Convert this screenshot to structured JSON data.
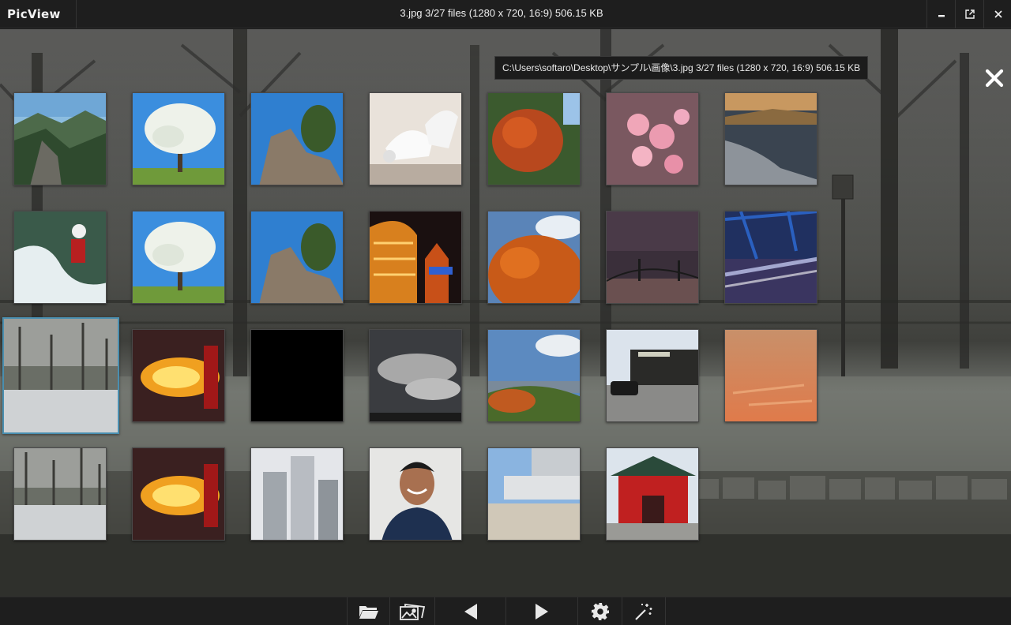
{
  "app": {
    "name": "PicView"
  },
  "titlebar": {
    "title": "3.jpg 3/27 files (1280 x 720, 16:9) 506.15 KB",
    "minimize_icon": "minimize-icon",
    "popout_icon": "open-external-icon",
    "close_icon": "close-icon"
  },
  "tooltip": {
    "text": "C:\\Users\\softaro\\Desktop\\サンプル\\画像\\3.jpg 3/27 files (1280 x 720, 16:9) 506.15 KB"
  },
  "gallery": {
    "selected_index": 14,
    "thumbnails": [
      {
        "subject": "mountain valley"
      },
      {
        "subject": "blossoming tree"
      },
      {
        "subject": "rock with pine tree"
      },
      {
        "subject": "seagulls"
      },
      {
        "subject": "autumn tree"
      },
      {
        "subject": "cherry blossoms"
      },
      {
        "subject": "rocky coast"
      },
      {
        "subject": "whitewater kayaker"
      },
      {
        "subject": "blossoming tree"
      },
      {
        "subject": "rock with pine tree"
      },
      {
        "subject": "lit building at night"
      },
      {
        "subject": "autumn tree"
      },
      {
        "subject": "suspension bridge at dusk"
      },
      {
        "subject": "city traffic at night"
      },
      {
        "subject": "winter park"
      },
      {
        "subject": "fire performers"
      },
      {
        "subject": "black image"
      },
      {
        "subject": "cloudy sky"
      },
      {
        "subject": "autumn hillside"
      },
      {
        "subject": "street with train station"
      },
      {
        "subject": "sunset sky"
      },
      {
        "subject": "winter park"
      },
      {
        "subject": "fire performers"
      },
      {
        "subject": "skyscrapers"
      },
      {
        "subject": "smiling man portrait"
      },
      {
        "subject": "modern building plaza"
      },
      {
        "subject": "red shrine gate"
      }
    ]
  },
  "toolbar": {
    "buttons": [
      {
        "icon": "folder-open-icon"
      },
      {
        "icon": "gallery-icon"
      },
      {
        "icon": "previous-icon"
      },
      {
        "icon": "next-icon"
      },
      {
        "icon": "settings-gear-icon"
      },
      {
        "icon": "magic-wand-icon"
      }
    ]
  },
  "colors": {
    "accent": "#4a8fb0",
    "chrome": "#1e1e1e"
  }
}
